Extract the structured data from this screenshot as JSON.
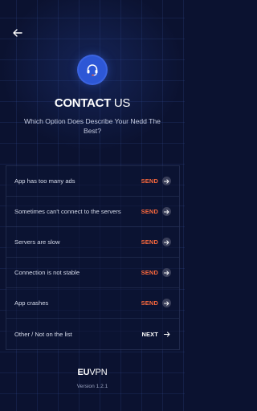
{
  "header": {
    "back_icon": "arrow-left-icon",
    "headset_icon": "headset-icon"
  },
  "title": {
    "bold": "CONTACT",
    "light": " US"
  },
  "subtitle": "Which Option Does Describe Your Nedd The Best?",
  "options": [
    {
      "label": "App has too many ads",
      "action": "SEND"
    },
    {
      "label": "Sometimes can't connect to the servers",
      "action": "SEND"
    },
    {
      "label": "Servers are slow",
      "action": "SEND"
    },
    {
      "label": "Connection is not stable",
      "action": "SEND"
    },
    {
      "label": "App crashes",
      "action": "SEND"
    },
    {
      "label": "Other / Not on the list",
      "action": "NEXT"
    }
  ],
  "brand": {
    "bold": "EU",
    "light": "VPN"
  },
  "version": "Version 1.2.1",
  "colors": {
    "background": "#0b1230",
    "accent_send": "#ff6a3d",
    "logo_blue": "#2d57d6"
  }
}
